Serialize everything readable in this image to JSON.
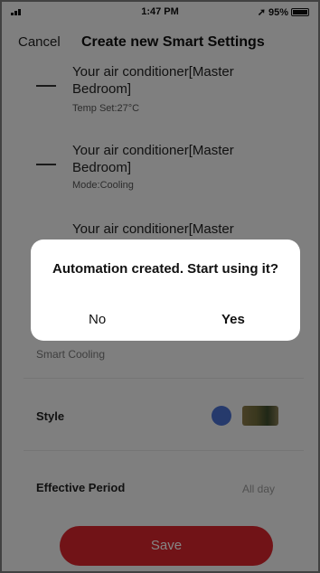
{
  "status_bar": {
    "time": "1:47 PM",
    "battery": "95%"
  },
  "nav": {
    "cancel": "Cancel",
    "title": "Create new Smart Settings"
  },
  "actions": [
    {
      "title": "Your air conditioner[Master Bedroom]",
      "detail": "Temp Set:27°C"
    },
    {
      "title": "Your air conditioner[Master Bedroom]",
      "detail": "Mode:Cooling"
    },
    {
      "title": "Your air conditioner[Master"
    }
  ],
  "automation_name": "Smart Cooling",
  "style": {
    "label": "Style",
    "color": "#4a6fd0"
  },
  "effective_period": {
    "label": "Effective Period",
    "value": "All day"
  },
  "save_label": "Save",
  "dialog": {
    "message": "Automation created. Start using it?",
    "no": "No",
    "yes": "Yes"
  }
}
